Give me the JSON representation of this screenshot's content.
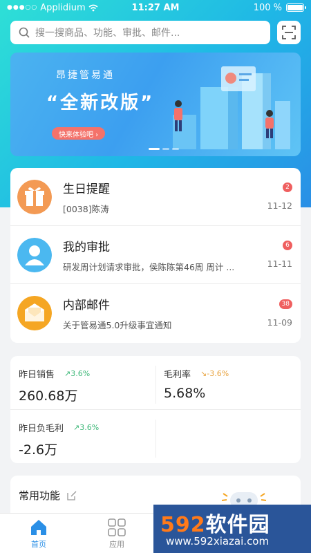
{
  "status_bar": {
    "carrier": "Applidium",
    "time": "11:27 AM",
    "battery": "100 %"
  },
  "search": {
    "placeholder": "搜一搜商品、功能、审批、邮件..."
  },
  "banner": {
    "subtitle": "昂捷管易通",
    "headline": "“全新改版”",
    "cta": "快来体验吧 ›"
  },
  "messages": [
    {
      "title": "生日提醒",
      "desc": "[0038]陈涛",
      "badge": "2",
      "date": "11-12",
      "icon": "gift-icon",
      "color": "#f39a54"
    },
    {
      "title": "我的审批",
      "desc": "研发周计划请求审批，侯陈陈第46周 周计 ...",
      "badge": "6",
      "date": "11-11",
      "icon": "user-avatar-icon",
      "color": "#4bb8f0"
    },
    {
      "title": "内部邮件",
      "desc": "关于管易通5.0升级事宜通知",
      "badge": "38",
      "date": "11-09",
      "icon": "mail-icon",
      "color": "#f5a623"
    }
  ],
  "stats": [
    {
      "label": "昨日销售",
      "trend": "↗3.6%",
      "direction": "up",
      "value": "260.68万"
    },
    {
      "label": "毛利率",
      "trend": "↘-3.6%",
      "direction": "down",
      "value": "5.68%"
    },
    {
      "label": "昨日负毛利",
      "trend": "↗3.6%",
      "direction": "up",
      "value": "-2.6万"
    }
  ],
  "functions": {
    "title": "常用功能"
  },
  "tabbar": {
    "home": "首页",
    "apps": "应用"
  },
  "watermark": {
    "big_prefix": "592",
    "big_suffix": "软件园",
    "url": "www.592xiazai.com"
  },
  "colors": {
    "accent": "#2a8fe6",
    "badge": "#ef5f5f",
    "trend_up": "#3cb777",
    "trend_down": "#e8a23d"
  }
}
